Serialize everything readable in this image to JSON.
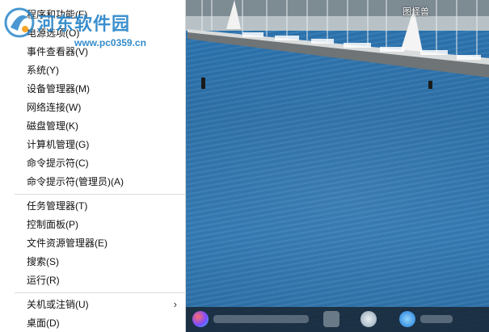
{
  "desktop": {
    "corner_label": "图怪兽"
  },
  "watermark": {
    "site_name": "河东软件园",
    "site_url": "www.pc0359.cn"
  },
  "menu": {
    "groups": [
      [
        {
          "label": "程序和功能(F)"
        },
        {
          "label": "电源选项(O)"
        },
        {
          "label": "事件查看器(V)"
        },
        {
          "label": "系统(Y)"
        },
        {
          "label": "设备管理器(M)"
        },
        {
          "label": "网络连接(W)"
        },
        {
          "label": "磁盘管理(K)"
        },
        {
          "label": "计算机管理(G)"
        },
        {
          "label": "命令提示符(C)"
        },
        {
          "label": "命令提示符(管理员)(A)"
        }
      ],
      [
        {
          "label": "任务管理器(T)"
        },
        {
          "label": "控制面板(P)"
        },
        {
          "label": "文件资源管理器(E)"
        },
        {
          "label": "搜索(S)"
        },
        {
          "label": "运行(R)"
        }
      ],
      [
        {
          "label": "关机或注销(U)",
          "submenu": "›"
        },
        {
          "label": "桌面(D)"
        }
      ]
    ]
  },
  "colors": {
    "brand": "#2a86c9",
    "sea": "#2b6fa3",
    "menu_bg": "#ffffff"
  }
}
